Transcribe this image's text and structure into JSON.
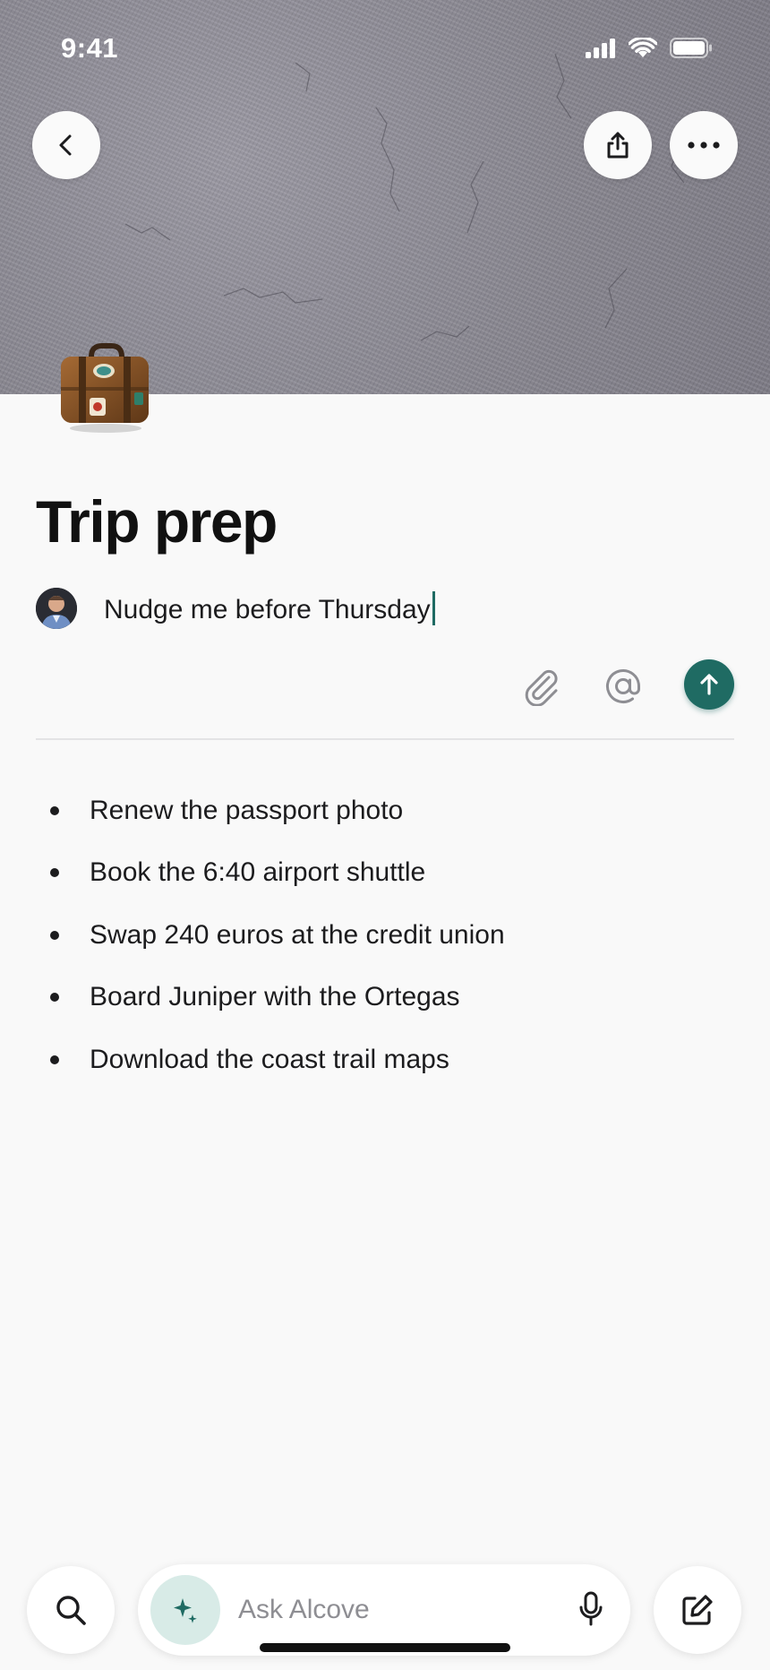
{
  "status_bar": {
    "time": "9:41"
  },
  "header": {
    "back_icon": "chevron-left-icon",
    "share_icon": "share-icon",
    "more_icon": "ellipsis-icon",
    "page_icon": "suitcase-icon"
  },
  "page": {
    "title": "Trip prep"
  },
  "comment": {
    "text": "Nudge me before Thursday",
    "attach_icon": "paperclip-icon",
    "mention_icon": "at-icon",
    "send_icon": "arrow-up-icon"
  },
  "list": {
    "items": [
      "Renew the passport photo",
      "Book the 6:40 airport shuttle",
      "Swap 240 euros at the credit union",
      "Board Juniper with the Ortegas",
      "Download the coast trail maps"
    ]
  },
  "bottom_bar": {
    "search_icon": "search-icon",
    "ask_placeholder": "Ask Alcove",
    "sparkle_icon": "sparkle-icon",
    "mic_icon": "microphone-icon",
    "compose_icon": "compose-icon"
  },
  "colors": {
    "accent": "#1f6b63",
    "accent_light": "#d8ebe7",
    "background": "#f9f9f9"
  }
}
